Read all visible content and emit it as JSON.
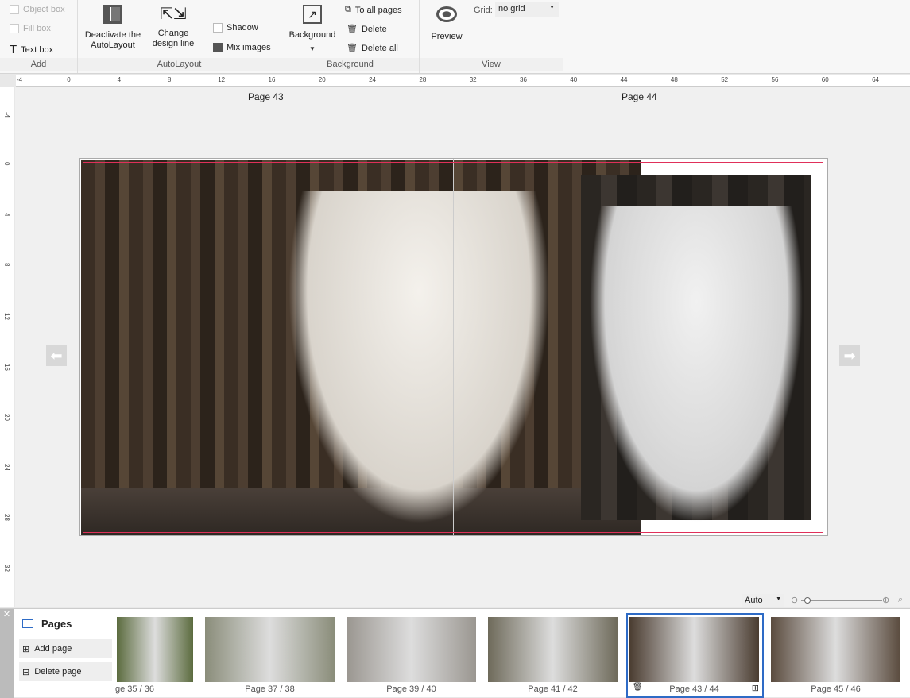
{
  "ribbon": {
    "add": {
      "label": "Add",
      "object_box": "Object box",
      "fill_box": "Fill box",
      "text_box": "Text box"
    },
    "autolayout": {
      "label": "AutoLayout",
      "deactivate": "Deactivate the AutoLayout",
      "change": "Change design line",
      "shadow": "Shadow",
      "mix": "Mix images"
    },
    "background": {
      "label": "Background",
      "background": "Background",
      "to_all": "To all pages",
      "delete": "Delete",
      "delete_all": "Delete all"
    },
    "view": {
      "label": "View",
      "preview": "Preview",
      "grid_label": "Grid:",
      "grid_value": "no grid"
    }
  },
  "ruler": {
    "top": [
      "-4",
      "0",
      "4",
      "8",
      "12",
      "16",
      "20",
      "24",
      "28",
      "32",
      "36",
      "40",
      "44",
      "48",
      "52",
      "56",
      "60",
      "64"
    ],
    "left": [
      "-4",
      "0",
      "4",
      "8",
      "12",
      "16",
      "20",
      "24",
      "28",
      "32"
    ]
  },
  "canvas": {
    "page_left": "Page 43",
    "page_right": "Page 44"
  },
  "zoom": {
    "value": "Auto"
  },
  "pages_panel": {
    "title": "Pages",
    "add": "Add page",
    "delete": "Delete page",
    "thumbs": [
      {
        "label": "ge 35 / 36"
      },
      {
        "label": "Page 37 / 38"
      },
      {
        "label": "Page 39 / 40"
      },
      {
        "label": "Page 41 / 42"
      },
      {
        "label": "Page 43 / 44",
        "selected": true
      },
      {
        "label": "Page 45 / 46"
      }
    ]
  },
  "colors": {
    "accent": "#2e6bc6",
    "trim": "#e0305a"
  }
}
